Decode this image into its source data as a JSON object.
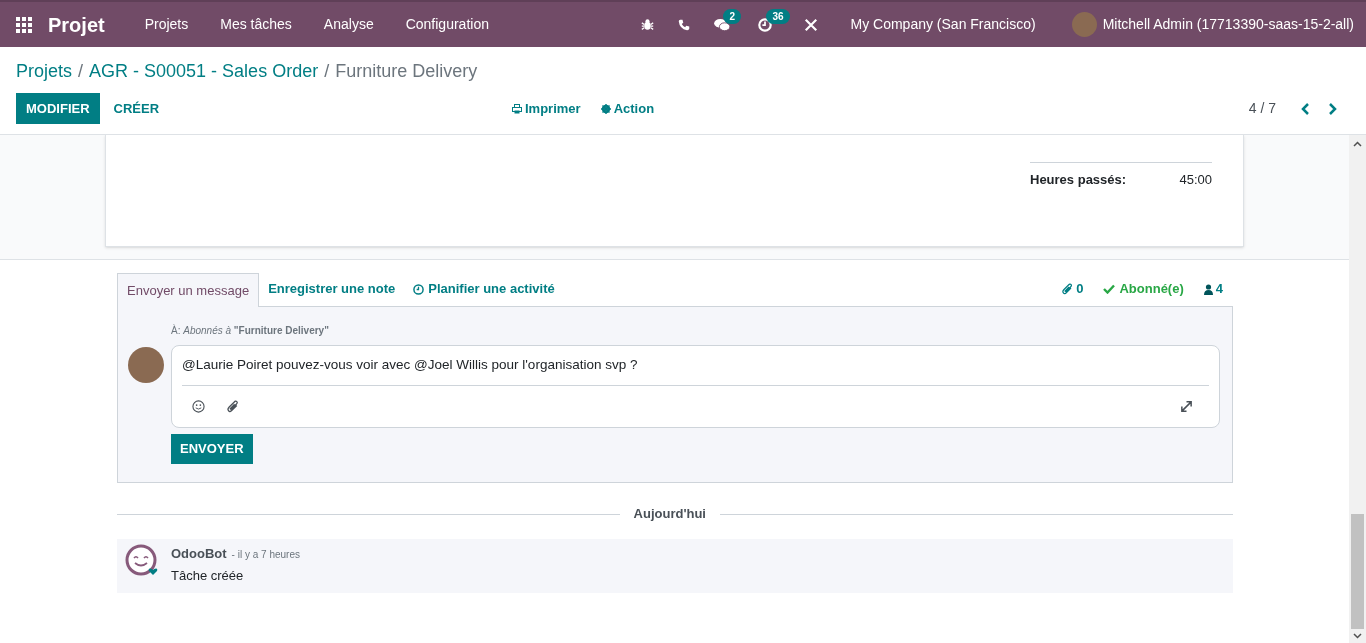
{
  "navbar": {
    "app_name": "Projet",
    "menu": [
      "Projets",
      "Mes tâches",
      "Analyse",
      "Configuration"
    ],
    "messages_count": "2",
    "activities_count": "36",
    "company": "My Company (San Francisco)",
    "user": "Mitchell Admin (17713390-saas-15-2-all)"
  },
  "breadcrumb": {
    "separators": [
      "/",
      "/"
    ],
    "items": [
      "Projets",
      "AGR - S00051 - Sales Order"
    ],
    "current": "Furniture Delivery"
  },
  "control_panel": {
    "edit_button": "MODIFIER",
    "create_button": "CRÉER",
    "actions": [
      {
        "kind": "print",
        "label": "Imprimer"
      },
      {
        "kind": "action",
        "label": "Action"
      }
    ],
    "pager": "4 / 7"
  },
  "form": {
    "field_label": "Heures passés:",
    "field_value": "45:00"
  },
  "chatter": {
    "tabs": [
      {
        "label": "Envoyer un message",
        "selected": true,
        "kind": "plain"
      },
      {
        "label": "Enregistrer une note",
        "selected": false,
        "kind": "plain"
      },
      {
        "label": "Planifier une activité",
        "selected": false,
        "kind": "clock"
      }
    ],
    "attachments_count": "0",
    "follow_status": "Abonné(e)",
    "followers_count": "4",
    "recipients": "À: *Abonnés à* **\"Furniture Delivery\"**",
    "message": "@Laurie Poiret pouvez-vous voir avec @Joel Willis pour l'organisation svp ?",
    "send_button": "ENVOYER",
    "date_separator": "Aujourd'hui",
    "messages": [
      {
        "author": "OdooBot",
        "date": "- il y a 7 heures",
        "body": "Tâche créée"
      }
    ]
  }
}
